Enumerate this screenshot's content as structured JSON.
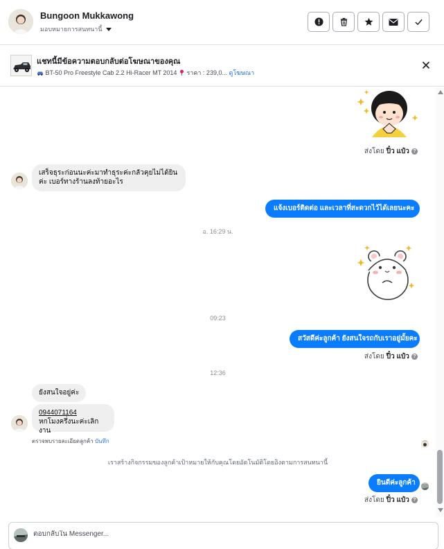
{
  "header": {
    "contact_name": "Bungoon Mukkawong",
    "assign_label": "มอบหมายการสนทนานี้",
    "actions": [
      "mark-spam",
      "delete",
      "star",
      "mark-unread",
      "done"
    ]
  },
  "ad_banner": {
    "title": "แชทนี้มีข้อความตอบกลับต่อโฆษณาของคุณ",
    "product": "BT-50 Pro Freestyle Cab 2.2 Hi-Racer MT 2014",
    "price": "ราคา : 239,0...",
    "view_ad": "ดูโฆษณา"
  },
  "messages": {
    "sent_by_prefix": "ส่งโดย",
    "sender": "ปิ๋ว แป๋ว",
    "in_1": "เสร็จธุระก่อนนะค่ะมาทำธุระค่ะกลัวคุยไม่ได้ยินค่ะ เบอร์ทางร้านลงท้ายอะไร",
    "out_1": "แจ้งเบอร์ติดต่อ  และเวลาที่สะดวกไว้ได้เลยนะคะ",
    "time_1": "อ. 16:29 น.",
    "time_2": "09:23",
    "out_2": "สวัสดีค่ะลูกค้า ยังสนใจรถกับเราอยู่มั้ยคะ",
    "time_3": "12:36",
    "in_2": "ยังสนใจอยู่ค่ะ",
    "in_3_phone": "0944071164",
    "in_3_text": "หกโมงครึ่งนะค่ะเลิกงาน",
    "details_note": "ตรวจพบรายละเอียดลูกค้า",
    "details_save": "บันทึก",
    "system_note": "เราสร้างกิจกรรมของลูกค้าเป้าหมายให้กับคุณโดยอัตโนมัติโดยอิงตามการสนทนานี้",
    "out_3": "ยินดีค่ะลูกค้า"
  },
  "composer": {
    "placeholder": "ตอบกลับใน Messenger..."
  },
  "colors": {
    "outgoing_bubble": "#0a7cff",
    "incoming_bubble": "#efefef",
    "link": "#216fdb"
  }
}
